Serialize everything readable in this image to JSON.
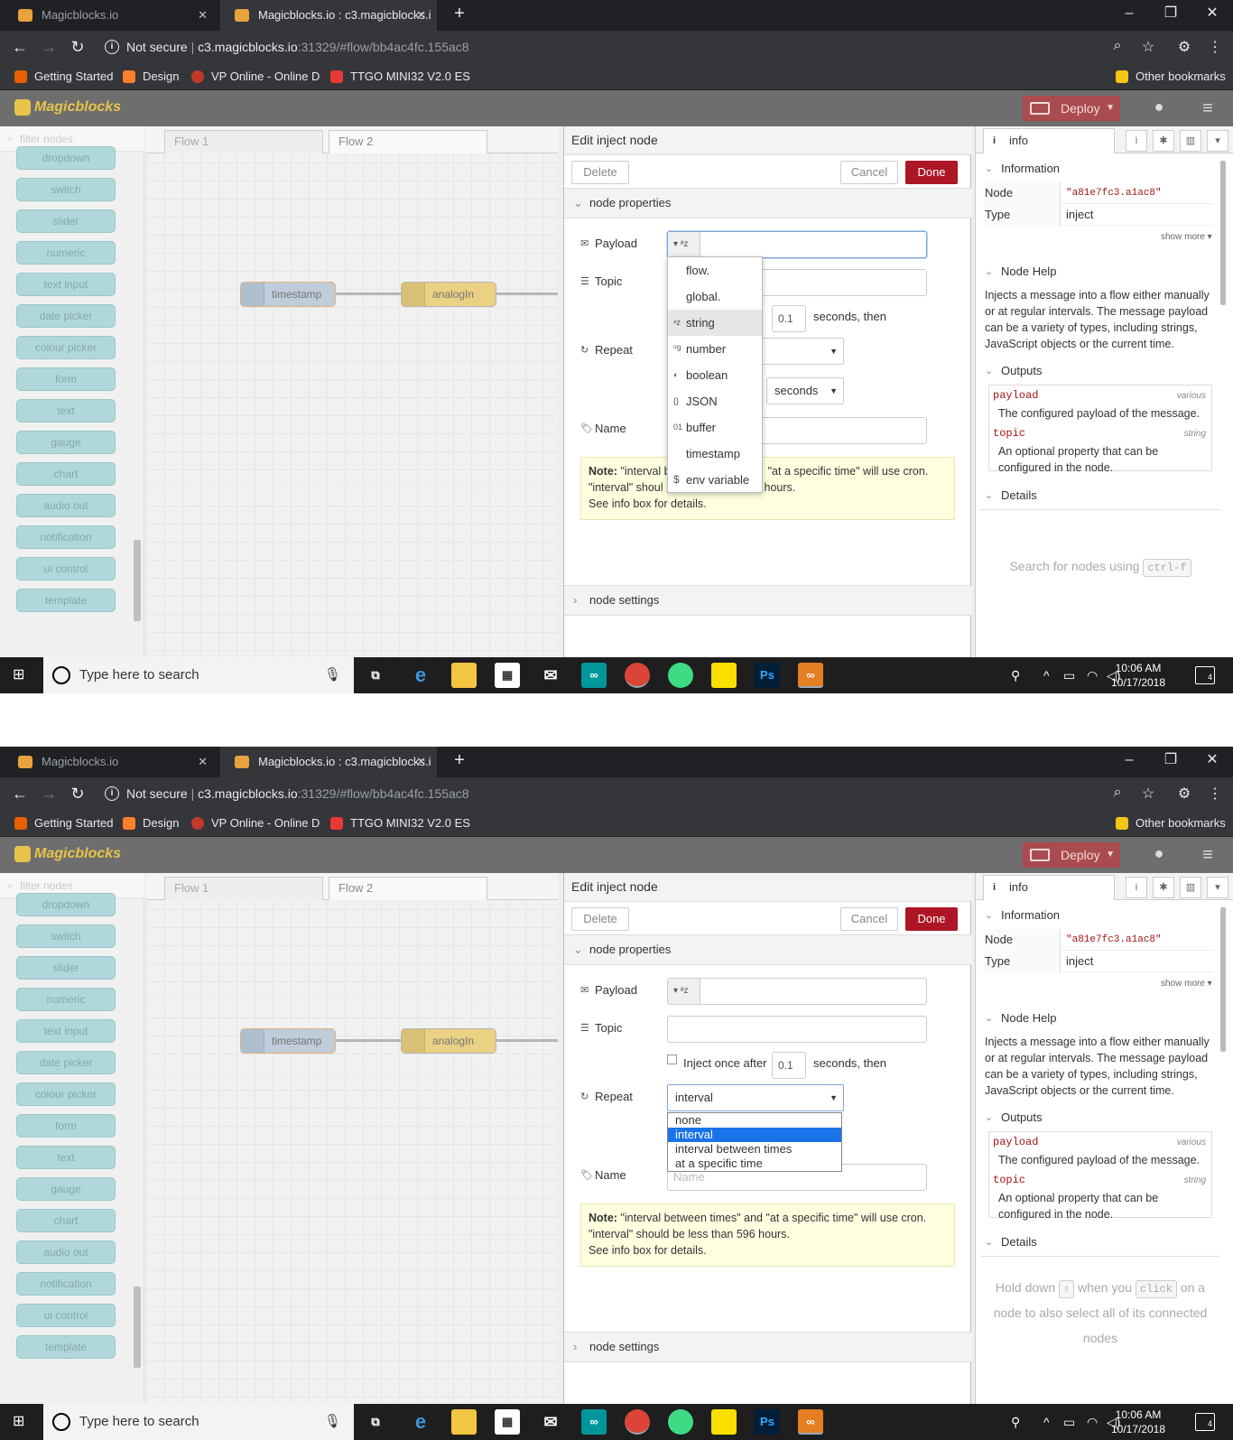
{
  "browser": {
    "tabs": [
      {
        "title": "Magicblocks.io"
      },
      {
        "title": "Magicblocks.io : c3.magicblocks.i"
      }
    ],
    "new_tab_icon": "plus-icon",
    "window_controls": {
      "minimize": "–",
      "maximize": "❐",
      "close": "✕"
    },
    "not_secure": "Not secure",
    "url_host": "c3.magicblocks.io",
    "url_rest": ":31329/#flow/bb4ac4fc.155ac8",
    "bookmarks": [
      "Getting Started",
      "Design",
      "VP Online - Online D",
      "TTGO MINI32 V2.0 ES"
    ],
    "other_bookmarks": "Other bookmarks"
  },
  "app": {
    "logo": "Magicblocks",
    "deploy": "Deploy"
  },
  "palette": {
    "filter_placeholder": "filter nodes",
    "nodes": [
      "dropdown",
      "switch",
      "slider",
      "numeric",
      "text input",
      "date picker",
      "colour picker",
      "form",
      "text",
      "gauge",
      "chart",
      "audio out",
      "notification",
      "ui control",
      "template"
    ]
  },
  "canvas": {
    "tabs": [
      "Flow 1",
      "Flow 2"
    ],
    "nodes": [
      "timestamp",
      "analogIn"
    ]
  },
  "editor": {
    "title": "Edit inject node",
    "delete": "Delete",
    "cancel": "Cancel",
    "done": "Done",
    "section_properties": "node properties",
    "section_settings": "node settings",
    "payload_label": "Payload",
    "topic_label": "Topic",
    "repeat_label": "Repeat",
    "name_label": "Name",
    "inject_once": "Inject once after",
    "inject_delay": "0.1",
    "seconds_then": "seconds, then",
    "units_value": "seconds",
    "repeat_value": "interval",
    "name_placeholder": "Name",
    "note_label": "Note:",
    "note_text": " \"interval between times\" and \"at a specific time\" will use cron.",
    "note_line2": "\"interval\" should be less than 596 hours.",
    "note_line3": "See info box for details.",
    "note_fragments": {
      "a": "\"interval b",
      "b": "\"at a specific time\" will use cron.",
      "c": "\"interval\" shoul",
      "d": "hours."
    },
    "type_options": [
      "flow.",
      "global.",
      "string",
      "number",
      "boolean",
      "JSON",
      "buffer",
      "timestamp",
      "env variable"
    ],
    "type_selected": "string",
    "repeat_options": [
      "none",
      "interval",
      "interval between times",
      "at a specific time"
    ]
  },
  "sidebar": {
    "tab": "info",
    "information": "Information",
    "node_key": "Node",
    "node_value": "\"a81e7fc3.a1ac8\"",
    "type_key": "Type",
    "type_value": "inject",
    "show_more": "show more",
    "node_help": "Node Help",
    "help_text": "Injects a message into a flow either manually or at regular intervals. The message payload can be a variety of types, including strings, JavaScript objects or the current time.",
    "outputs": "Outputs",
    "payload_name": "payload",
    "payload_type": "various",
    "payload_desc": "The configured payload of the message.",
    "topic_name": "topic",
    "topic_type": "string",
    "topic_desc": "An optional property that can be configured in the node.",
    "details": "Details",
    "tip1_text": "Search for nodes using",
    "tip1_key": "ctrl-f",
    "tip2_a": "Hold down",
    "tip2_key1": "⇧",
    "tip2_b": "when you",
    "tip2_key2": "click",
    "tip2_c": "on a node to also select all of its connected nodes"
  },
  "taskbar": {
    "search": "Type here to search",
    "time": "10:06 AM",
    "date": "10/17/2018",
    "notifications": "4"
  }
}
